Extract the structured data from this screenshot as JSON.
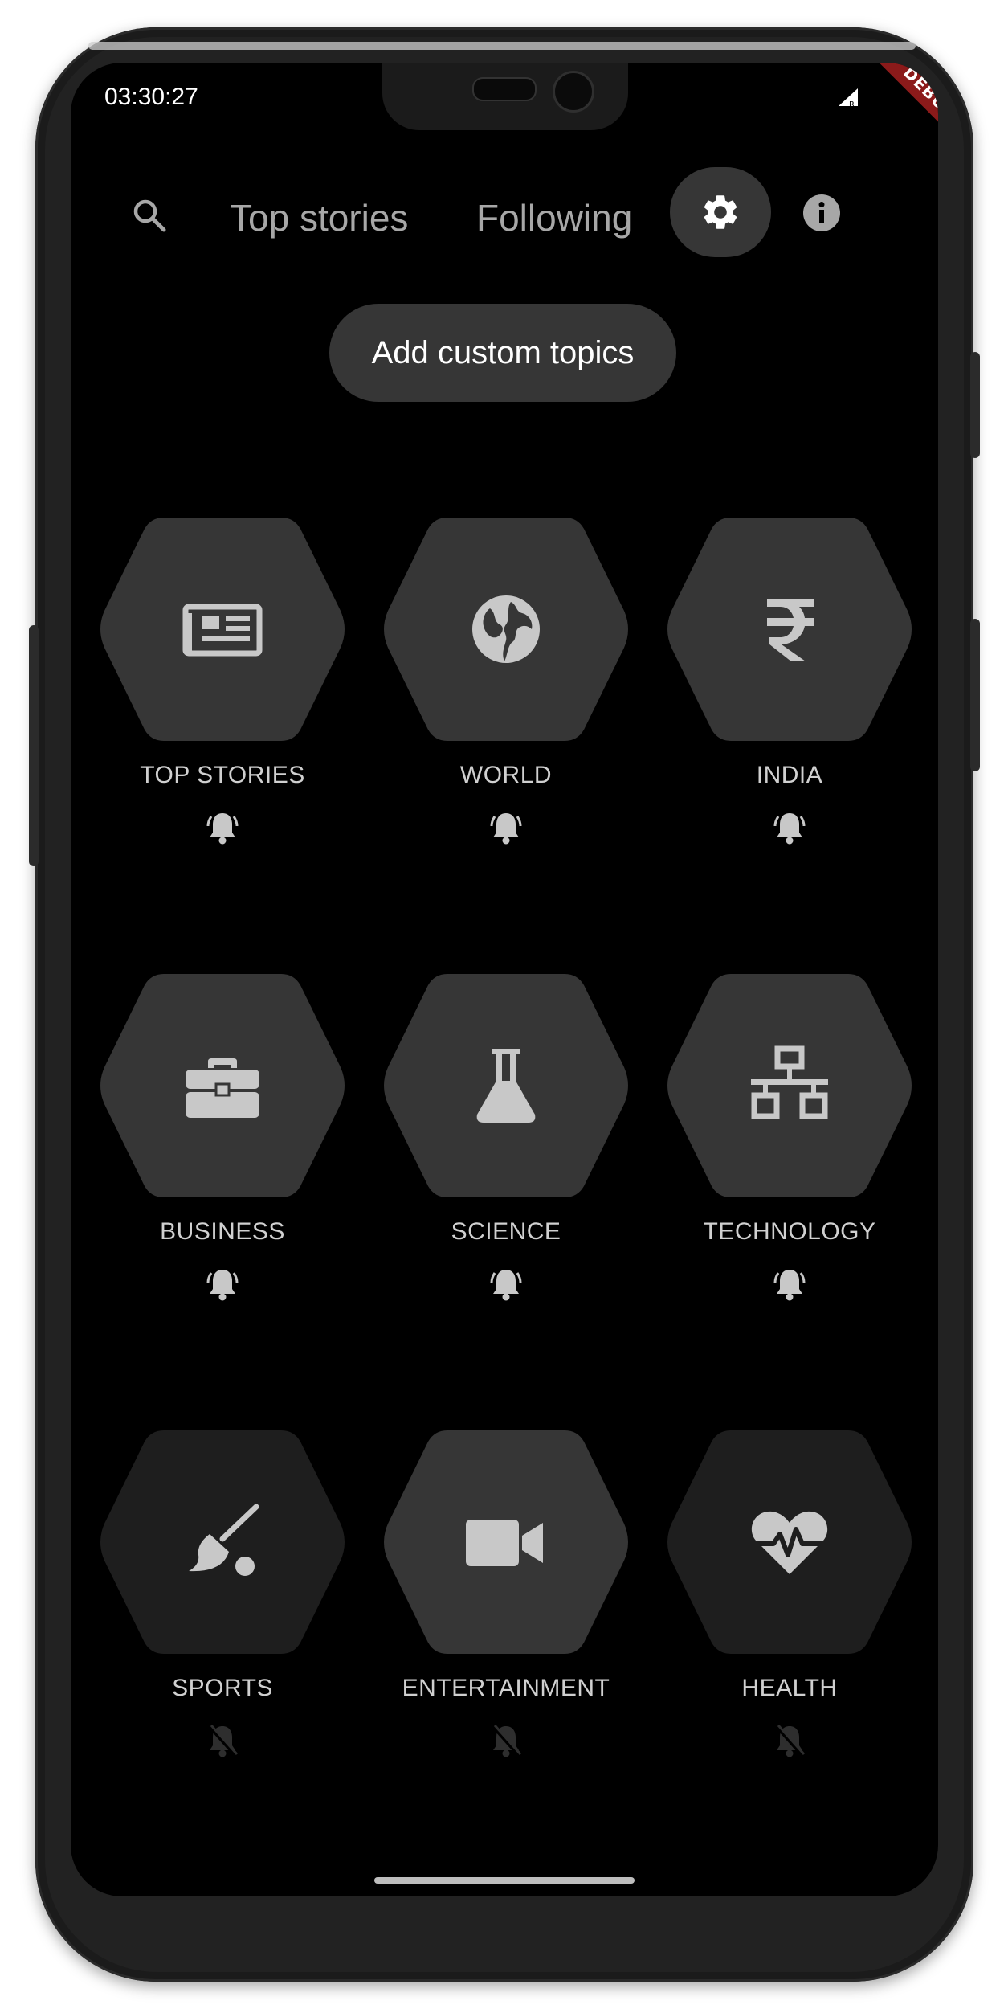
{
  "status_bar": {
    "time": "03:30:27",
    "debug_label": "DEBUG"
  },
  "nav": {
    "tabs": [
      "Top stories",
      "Following"
    ],
    "search_icon": "search-icon",
    "settings_icon": "gear-icon",
    "info_icon": "info-icon"
  },
  "add_topics_label": "Add custom topics",
  "colors": {
    "background": "#000000",
    "hex_active": "#363636",
    "hex_inactive": "#1e1e1e",
    "icon": "#c8c8c8",
    "bell_active": "#c8c8c8",
    "bell_muted": "#2e2e2e"
  },
  "topics": [
    {
      "label": "TOP STORIES",
      "icon": "newspaper-icon",
      "notifications": "on"
    },
    {
      "label": "WORLD",
      "icon": "globe-icon",
      "notifications": "on"
    },
    {
      "label": "INDIA",
      "icon": "rupee-icon",
      "notifications": "on"
    },
    {
      "label": "BUSINESS",
      "icon": "briefcase-icon",
      "notifications": "on"
    },
    {
      "label": "SCIENCE",
      "icon": "flask-icon",
      "notifications": "on"
    },
    {
      "label": "TECHNOLOGY",
      "icon": "network-icon",
      "notifications": "on"
    },
    {
      "label": "SPORTS",
      "icon": "broom-ball-icon",
      "notifications": "off"
    },
    {
      "label": "ENTERTAINMENT",
      "icon": "video-camera-icon",
      "notifications": "off"
    },
    {
      "label": "HEALTH",
      "icon": "heartbeat-icon",
      "notifications": "off"
    }
  ]
}
